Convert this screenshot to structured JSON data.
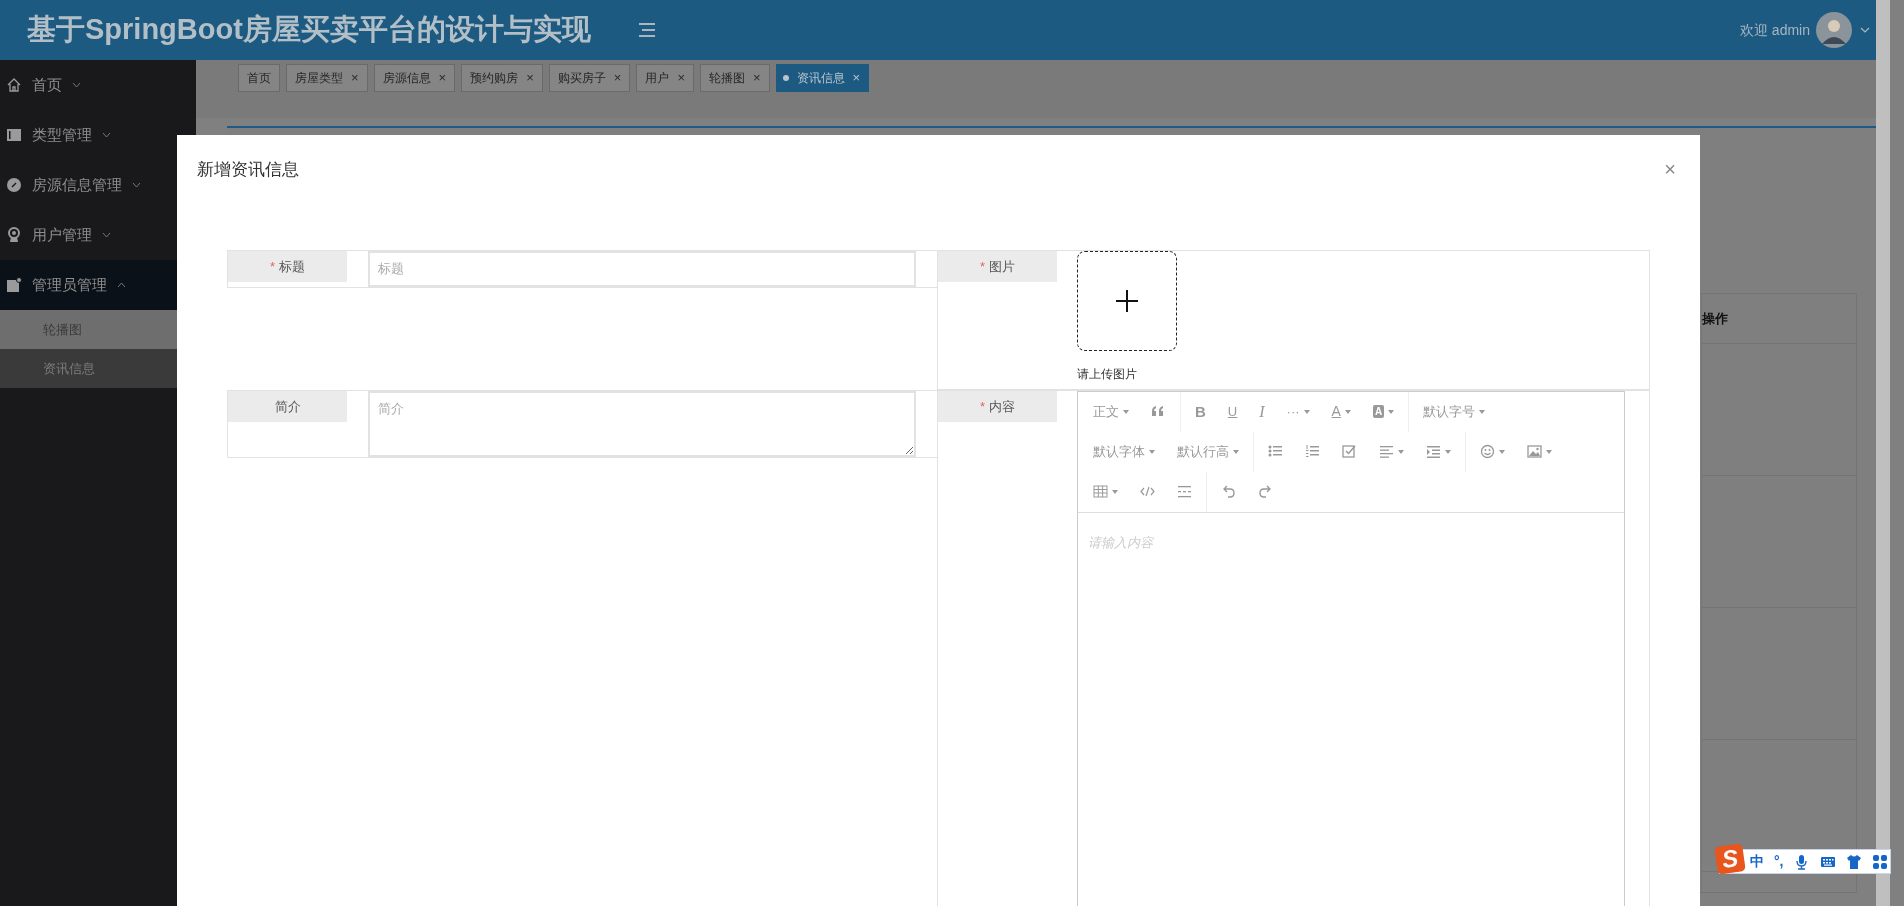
{
  "header": {
    "title": "基于SpringBoot房屋买卖平台的设计与实现",
    "greeting": "欢迎 admin"
  },
  "sidebar": {
    "items": [
      {
        "label": "首页",
        "expanded": false
      },
      {
        "label": "类型管理",
        "expanded": false
      },
      {
        "label": "房源信息管理",
        "expanded": false
      },
      {
        "label": "用户管理",
        "expanded": false
      },
      {
        "label": "管理员管理",
        "expanded": true,
        "children": [
          {
            "label": "轮播图",
            "selected": false
          },
          {
            "label": "资讯信息",
            "selected": true
          }
        ]
      }
    ]
  },
  "tabs": [
    {
      "label": "首页",
      "selected": false
    },
    {
      "label": "房屋类型",
      "close": "×",
      "selected": false
    },
    {
      "label": "房源信息",
      "close": "×",
      "selected": false
    },
    {
      "label": "预约购房",
      "close": "×",
      "selected": false
    },
    {
      "label": "购买房子",
      "close": "×",
      "selected": false
    },
    {
      "label": "用户",
      "close": "×",
      "selected": false
    },
    {
      "label": "轮播图",
      "close": "×",
      "selected": false
    },
    {
      "label": "资讯信息",
      "close": "×",
      "selected": true
    }
  ],
  "table": {
    "columns": [
      "操作"
    ]
  },
  "modal": {
    "title": "新增资讯信息",
    "close": "×",
    "fields": [
      {
        "kind": "input",
        "label": "标题",
        "required_mark": "*",
        "placeholder": "标题"
      },
      {
        "kind": "upload",
        "label": "图片",
        "required_mark": "*",
        "hint": "请上传图片"
      },
      {
        "kind": "textarea",
        "label": "简介",
        "placeholder": "简介"
      },
      {
        "kind": "editor",
        "label": "内容",
        "required_mark": "*",
        "placeholder": "请输入内容",
        "toolbar_rows": [
          [
            {
              "kind": "text",
              "label": "正文",
              "caret": true
            },
            {
              "kind": "quote",
              "caret": false
            },
            {
              "kind": "divider"
            },
            {
              "kind": "bold",
              "label": "B",
              "caret": false
            },
            {
              "kind": "underline",
              "label": "U",
              "caret": false
            },
            {
              "kind": "italic",
              "label": "I",
              "caret": false
            },
            {
              "kind": "text",
              "label": "···",
              "caret": true
            },
            {
              "kind": "fontcolor",
              "label": "A",
              "caret": true
            },
            {
              "kind": "bgcolor",
              "label": "A",
              "caret": true
            },
            {
              "kind": "divider"
            },
            {
              "kind": "text",
              "label": "默认字号",
              "caret": true
            }
          ],
          [
            {
              "kind": "text",
              "label": "默认字体",
              "caret": true
            },
            {
              "kind": "text",
              "label": "默认行高",
              "caret": true
            },
            {
              "kind": "divider"
            },
            {
              "kind": "bulletlist",
              "caret": false
            },
            {
              "kind": "numberlist",
              "caret": false
            },
            {
              "kind": "todo",
              "caret": false
            },
            {
              "kind": "align",
              "caret": true
            },
            {
              "kind": "indent",
              "caret": true
            },
            {
              "kind": "divider"
            },
            {
              "kind": "emoji",
              "caret": true
            },
            {
              "kind": "image",
              "caret": true
            }
          ],
          [
            {
              "kind": "table",
              "caret": true
            },
            {
              "kind": "code",
              "caret": false
            },
            {
              "kind": "splitline",
              "caret": false
            },
            {
              "kind": "divider"
            },
            {
              "kind": "undo",
              "caret": false
            },
            {
              "kind": "redo",
              "caret": false
            }
          ]
        ]
      }
    ]
  },
  "ime": {
    "logo": "S",
    "items": [
      {
        "kind": "text",
        "label": "中"
      },
      {
        "kind": "text",
        "label": "°,"
      },
      {
        "kind": "mic"
      },
      {
        "kind": "keyboard"
      },
      {
        "kind": "shirt"
      },
      {
        "kind": "apps"
      }
    ]
  }
}
